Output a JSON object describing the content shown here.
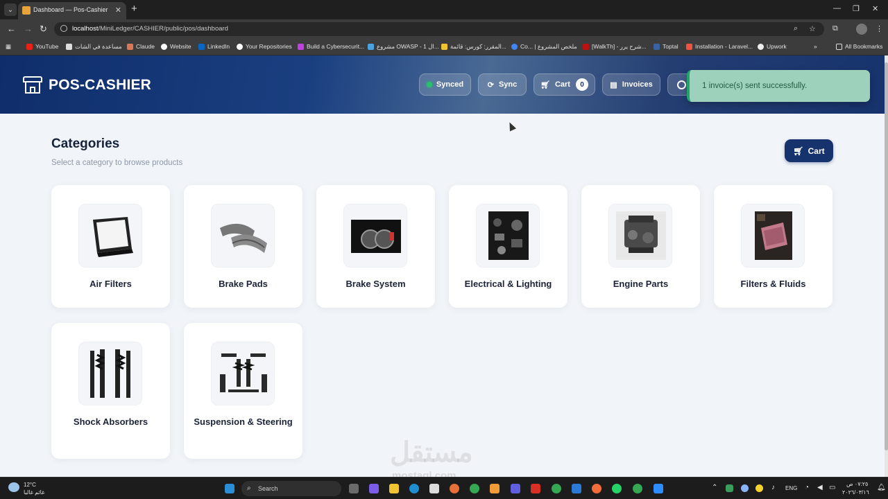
{
  "browser": {
    "tab_title": "Dashboard — Pos-Cashier",
    "url_host": "localhost",
    "url_path": "/MiniLedger/CASHIER/public/pos/dashboard",
    "bookmarks": [
      "YouTube",
      "مساعدة في الشات",
      "Claude",
      "Website",
      "LinkedIn",
      "Your Repositories",
      "Build a Cybersecurit...",
      "مشروع OWASP - ال 1...",
      "المقرر: كورس: قائمة...",
      "Co... | ملخص المشروع",
      "[WalkTh] - شرح يرر...",
      "Toptal",
      "Installation - Laravel...",
      "Upwork"
    ],
    "all_bookmarks": "All Bookmarks"
  },
  "header": {
    "brand": "POS-CASHIER",
    "synced_label": "Synced",
    "sync_label": "Sync",
    "cart_label": "Cart",
    "cart_count": "0",
    "invoices_label": "Invoices"
  },
  "toast": {
    "message": "1 invoice(s) sent successfully."
  },
  "main": {
    "title": "Categories",
    "subtitle": "Select a category to browse products",
    "cart_button": "Cart",
    "categories": [
      {
        "name": "Air Filters"
      },
      {
        "name": "Brake Pads"
      },
      {
        "name": "Brake System"
      },
      {
        "name": "Electrical & Lighting"
      },
      {
        "name": "Engine Parts"
      },
      {
        "name": "Filters & Fluids"
      },
      {
        "name": "Shock Absorbers"
      },
      {
        "name": "Suspension & Steering"
      }
    ]
  },
  "taskbar": {
    "weather_temp": "12°C",
    "weather_desc": "غائم غالبا",
    "search_label": "Search",
    "lang": "ENG",
    "time": "٠٧:٢٥ ص",
    "date": "٢٠٢٦/٠٣/١٦"
  },
  "watermark": {
    "text": "مستقل",
    "sub": "mostaql.com"
  }
}
